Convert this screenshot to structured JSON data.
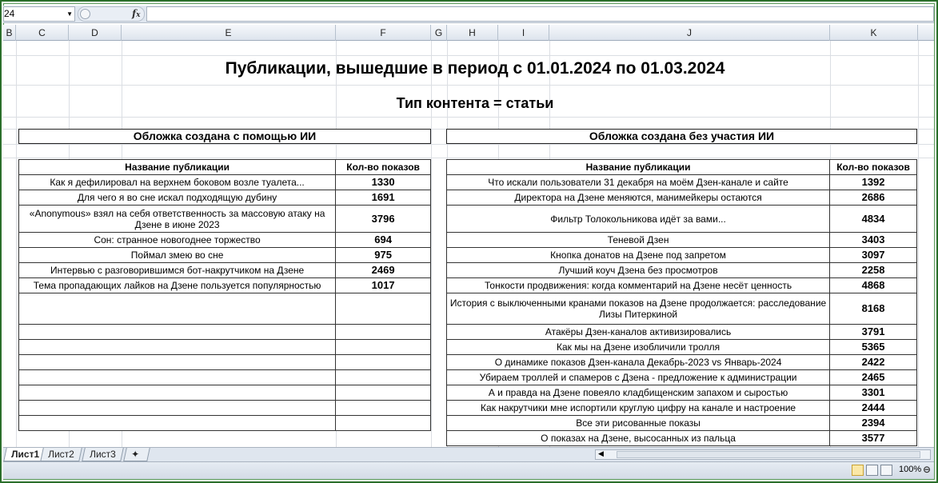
{
  "formula_bar": {
    "cell_ref": "24",
    "fx_label": "fx"
  },
  "columns": [
    "B",
    "C",
    "D",
    "E",
    "F",
    "G",
    "H",
    "I",
    "J",
    "K"
  ],
  "titles": {
    "main": "Публикации, вышедшие в период с 01.01.2024 по 01.03.2024",
    "sub": "Тип контента = статьи"
  },
  "left_table": {
    "heading": "Обложка создана с помощью ИИ",
    "col_name": "Название публикации",
    "col_views": "Кол-во показов",
    "rows": [
      {
        "name": "Как я дефилировал на верхнем боковом возле туалета...",
        "views": "1330"
      },
      {
        "name": "Для чего я во сне искал подходящую дубину",
        "views": "1691"
      },
      {
        "name": "«Anonymous» взял на себя ответственность за массовую атаку на Дзене в июне 2023",
        "views": "3796"
      },
      {
        "name": "Сон: странное новогоднее торжество",
        "views": "694"
      },
      {
        "name": "Поймал змею во сне",
        "views": "975"
      },
      {
        "name": "Интервью с разговорившимся бот-накрутчиком на Дзене",
        "views": "2469"
      },
      {
        "name": "Тема пропадающих лайков на Дзене пользуется популярностью",
        "views": "1017"
      }
    ]
  },
  "right_table": {
    "heading": "Обложка создана без участия ИИ",
    "col_name": "Название публикации",
    "col_views": "Кол-во показов",
    "rows": [
      {
        "name": "Что искали пользователи 31 декабря на моём Дзен-канале и сайте",
        "views": "1392"
      },
      {
        "name": "Директора на Дзене меняются, манимейкеры остаются",
        "views": "2686"
      },
      {
        "name": "Фильтр Толокольникова идёт за вами...",
        "views": "4834"
      },
      {
        "name": "Теневой Дзен",
        "views": "3403"
      },
      {
        "name": "Кнопка донатов на Дзене под запретом",
        "views": "3097"
      },
      {
        "name": "Лучший коуч Дзена без просмотров",
        "views": "2258"
      },
      {
        "name": "Тонкости продвижения: когда комментарий на Дзене несёт ценность",
        "views": "4868"
      },
      {
        "name": "История с выключенными кранами показов на Дзене продолжается: расследование Лизы Питеркиной",
        "views": "8168"
      },
      {
        "name": "Атакёры Дзен-каналов активизировались",
        "views": "3791"
      },
      {
        "name": "Как мы на Дзене изобличили тролля",
        "views": "5365"
      },
      {
        "name": "О динамике показов Дзен-канала Декабрь-2023 vs Январь-2024",
        "views": "2422"
      },
      {
        "name": "Убираем троллей и спамеров с Дзена - предложение к администрации",
        "views": "2465"
      },
      {
        "name": "А и правда на Дзене повеяло кладбищенским запахом и сыростью",
        "views": "3301"
      },
      {
        "name": "Как накрутчики мне испортили круглую цифру на канале и настроение",
        "views": "2444"
      },
      {
        "name": "Все эти рисованные показы",
        "views": "2394"
      },
      {
        "name": "О показах на Дзене, высосанных из пальца",
        "views": "3577"
      }
    ]
  },
  "sheet_tabs": [
    "Лист1",
    "Лист2",
    "Лист3"
  ],
  "status": {
    "zoom": "100%"
  }
}
